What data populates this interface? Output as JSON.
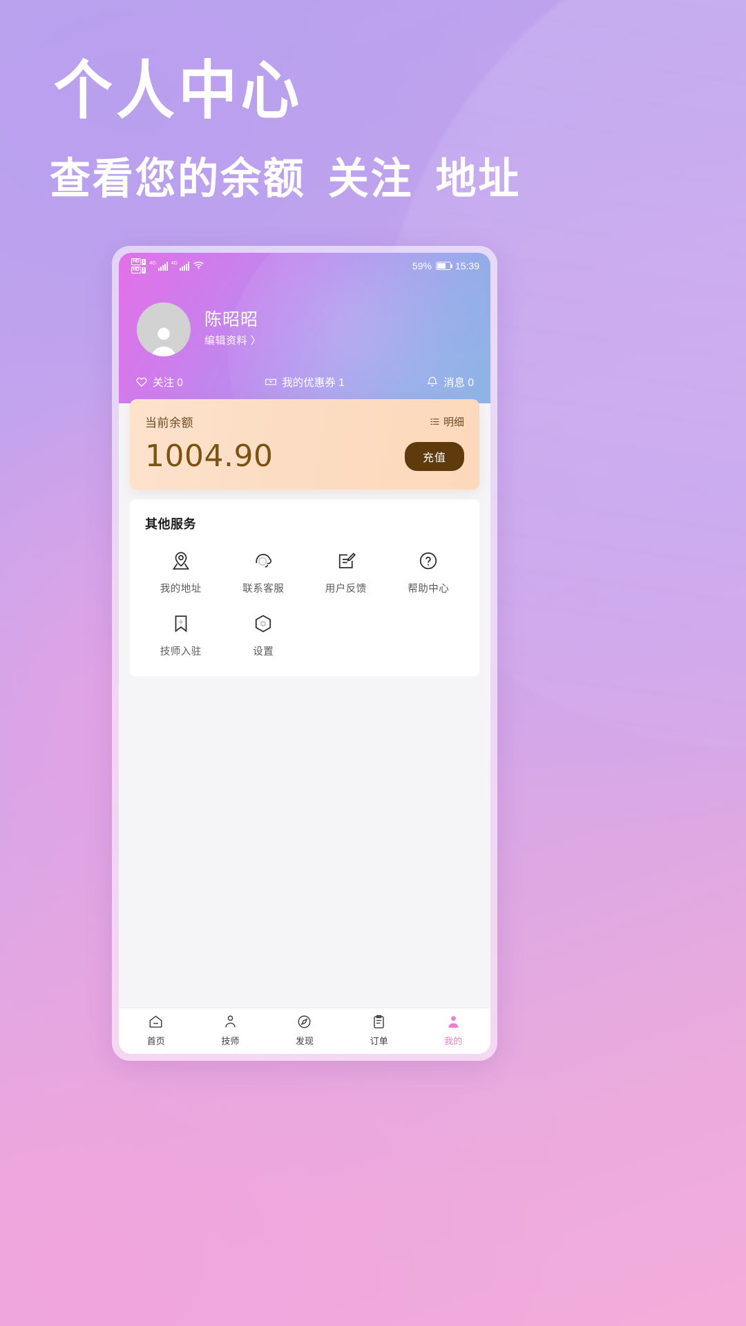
{
  "promo": {
    "title": "个人中心",
    "subtitle_parts": [
      "查看您的余额",
      "关注",
      "地址"
    ]
  },
  "statusbar": {
    "hd1_label": "HD",
    "hd1_num": "1",
    "hd2_label": "HD",
    "hd2_num": "2",
    "net1": "4G",
    "net2": "4G",
    "battery_percent": "59%",
    "time": "15:39"
  },
  "profile": {
    "name": "陈昭昭",
    "edit_label": "编辑资料 〉"
  },
  "stats": [
    {
      "label": "关注 0",
      "icon": "heart-icon"
    },
    {
      "label": "我的优惠券 1",
      "icon": "coupon-icon"
    },
    {
      "label": "消息 0",
      "icon": "bell-icon"
    }
  ],
  "balance": {
    "label": "当前余额",
    "detail_label": "明细",
    "amount": "1004.90",
    "recharge_label": "充值"
  },
  "services": {
    "title": "其他服务",
    "items": [
      {
        "label": "我的地址",
        "icon": "location-pin-icon"
      },
      {
        "label": "联系客服",
        "icon": "headset-icon"
      },
      {
        "label": "用户反馈",
        "icon": "edit-note-icon"
      },
      {
        "label": "帮助中心",
        "icon": "question-circle-icon"
      },
      {
        "label": "技师入驻",
        "icon": "bookmark-plus-icon"
      },
      {
        "label": "设置",
        "icon": "settings-hexagon-icon"
      }
    ]
  },
  "tabbar": {
    "items": [
      {
        "label": "首页",
        "icon": "home-icon",
        "active": false
      },
      {
        "label": "技师",
        "icon": "technician-icon",
        "active": false
      },
      {
        "label": "发现",
        "icon": "discover-icon",
        "active": false
      },
      {
        "label": "订单",
        "icon": "order-clipboard-icon",
        "active": false
      },
      {
        "label": "我的",
        "icon": "profile-person-icon",
        "active": true
      }
    ]
  },
  "colors": {
    "accent_pink": "#f07ec8",
    "balance_card": "#fde2cc",
    "balance_text": "#7a5312",
    "recharge_button": "#5e3a0c"
  }
}
